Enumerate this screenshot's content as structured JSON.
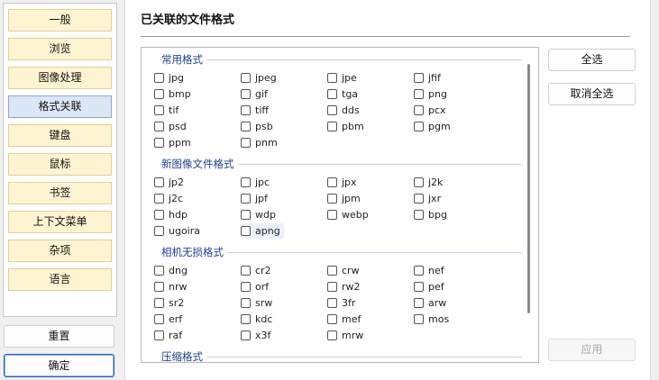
{
  "sidebar": {
    "items": [
      {
        "label": "一般"
      },
      {
        "label": "浏览"
      },
      {
        "label": "图像处理"
      },
      {
        "label": "格式关联",
        "active": true
      },
      {
        "label": "键盘"
      },
      {
        "label": "鼠标"
      },
      {
        "label": "书签"
      },
      {
        "label": "上下文菜单"
      },
      {
        "label": "杂项"
      },
      {
        "label": "语言"
      }
    ],
    "reset_label": "重置",
    "ok_label": "确定"
  },
  "main": {
    "title": "已关联的文件格式",
    "select_all_label": "全选",
    "deselect_all_label": "取消全选",
    "apply_label": "应用",
    "groups": [
      {
        "title": "常用格式",
        "items": [
          "jpg",
          "jpeg",
          "jpe",
          "jfif",
          "bmp",
          "gif",
          "tga",
          "png",
          "tif",
          "tiff",
          "dds",
          "pcx",
          "psd",
          "psb",
          "pbm",
          "pgm",
          "ppm",
          "pnm"
        ]
      },
      {
        "title": "新图像文件格式",
        "items": [
          "jp2",
          "jpc",
          "jpx",
          "j2k",
          "j2c",
          "jpf",
          "jpm",
          "jxr",
          "hdp",
          "wdp",
          "webp",
          "bpg",
          "ugoira",
          "apng"
        ]
      },
      {
        "title": "相机无损格式",
        "items": [
          "dng",
          "cr2",
          "crw",
          "nef",
          "nrw",
          "orf",
          "rw2",
          "pef",
          "sr2",
          "srw",
          "3fr",
          "arw",
          "erf",
          "kdc",
          "mef",
          "mos",
          "raf",
          "x3f",
          "mrw"
        ]
      },
      {
        "title": "压缩格式",
        "items": []
      }
    ]
  }
}
